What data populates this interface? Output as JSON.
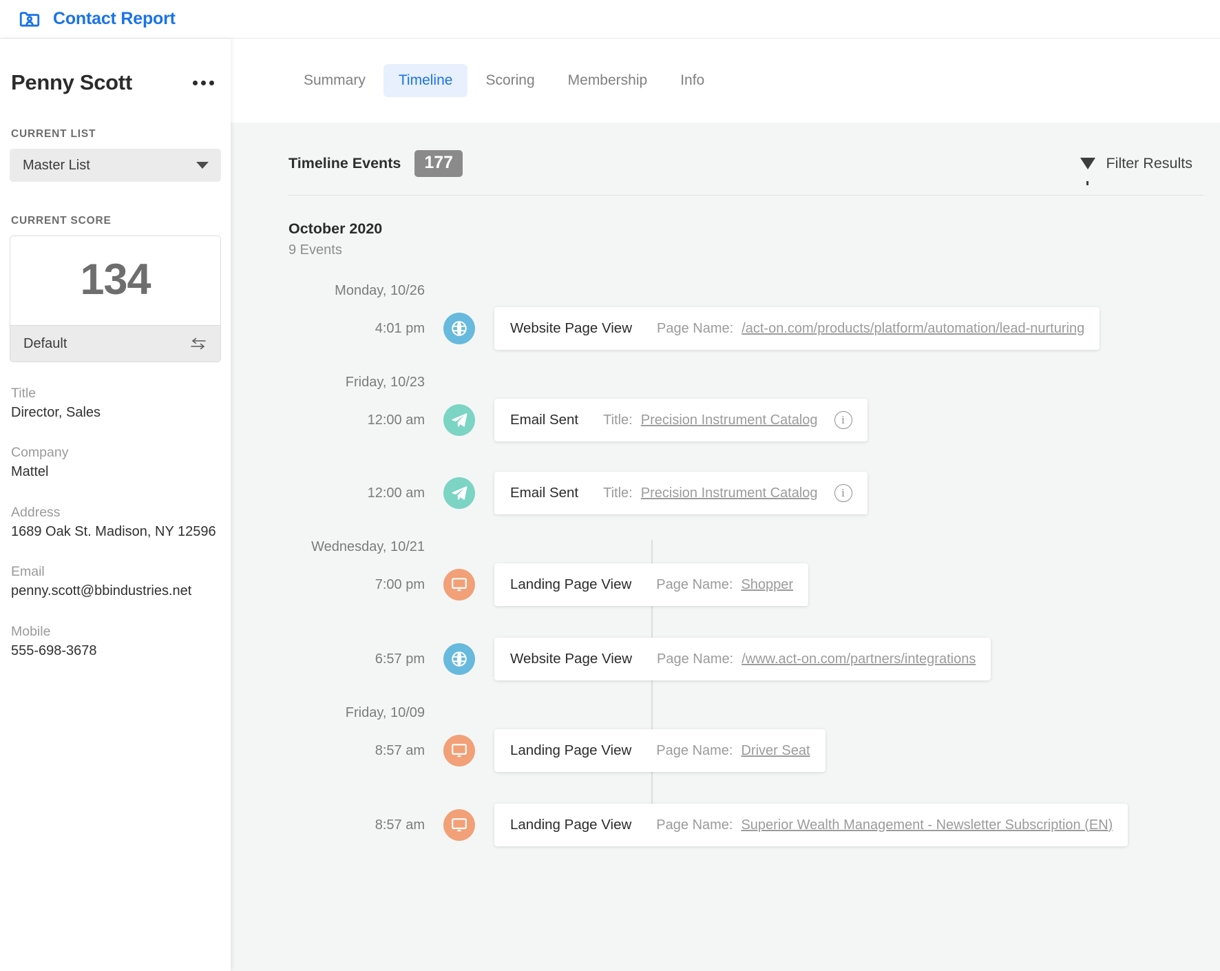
{
  "app": {
    "title": "Contact Report",
    "brand_color": "#1a73e8",
    "brand_icon": "contact-folder-icon"
  },
  "sidebar": {
    "contact_name": "Penny Scott",
    "more_actions_icon": "kebab-menu-icon",
    "current_list": {
      "label": "CURRENT LIST",
      "selected": "Master List",
      "caret_icon": "chevron-down-icon"
    },
    "current_score": {
      "label": "CURRENT SCORE",
      "value": "134",
      "sheet_name": "Default",
      "swap_icon": "swap-arrows-icon"
    },
    "fields": [
      {
        "label": "Title",
        "value": "Director, Sales"
      },
      {
        "label": "Company",
        "value": "Mattel"
      },
      {
        "label": "Address",
        "value": "1689 Oak St. Madison, NY 12596"
      },
      {
        "label": "Email",
        "value": "penny.scott@bbindustries.net"
      },
      {
        "label": "Mobile",
        "value": "555-698-3678"
      }
    ]
  },
  "main": {
    "tabs": [
      {
        "label": "Summary",
        "active": false
      },
      {
        "label": "Timeline",
        "active": true
      },
      {
        "label": "Scoring",
        "active": false
      },
      {
        "label": "Membership",
        "active": false
      },
      {
        "label": "Info",
        "active": false
      }
    ],
    "events_header": {
      "title": "Timeline Events",
      "count": "177",
      "filter_label": "Filter Results",
      "filter_icon": "funnel-icon"
    },
    "timeline": {
      "month": "October 2020",
      "month_count": "9 Events",
      "days": [
        {
          "label": "Monday, 10/26",
          "events": [
            {
              "time": "4:01 pm",
              "icon": "globe-icon",
              "marker": "globe",
              "type": "Website Page View",
              "key": "Page Name:",
              "value": "/act-on.com/products/platform/automation/lead-nurturing",
              "has_info": false
            }
          ]
        },
        {
          "label": "Friday, 10/23",
          "events": [
            {
              "time": "12:00 am",
              "icon": "paper-plane-icon",
              "marker": "plane",
              "type": "Email Sent",
              "key": "Title:",
              "value": "Precision Instrument Catalog",
              "has_info": true
            },
            {
              "time": "12:00 am",
              "icon": "paper-plane-icon",
              "marker": "plane",
              "type": "Email Sent",
              "key": "Title:",
              "value": "Precision Instrument Catalog",
              "has_info": true
            }
          ]
        },
        {
          "label": "Wednesday, 10/21",
          "events": [
            {
              "time": "7:00 pm",
              "icon": "monitor-icon",
              "marker": "screen",
              "type": "Landing Page View",
              "key": "Page Name:",
              "value": "Shopper",
              "has_info": false
            },
            {
              "time": "6:57 pm",
              "icon": "globe-icon",
              "marker": "globe",
              "type": "Website Page View",
              "key": "Page Name:",
              "value": "/www.act-on.com/partners/integrations",
              "has_info": false
            }
          ]
        },
        {
          "label": "Friday, 10/09",
          "events": [
            {
              "time": "8:57 am",
              "icon": "monitor-icon",
              "marker": "screen",
              "type": "Landing Page View",
              "key": "Page Name:",
              "value": "Driver Seat",
              "has_info": false
            },
            {
              "time": "8:57 am",
              "icon": "monitor-icon",
              "marker": "screen",
              "type": "Landing Page View",
              "key": "Page Name:",
              "value": "Superior Wealth Management - Newsletter Subscription (EN)",
              "has_info": false
            }
          ]
        }
      ]
    }
  }
}
